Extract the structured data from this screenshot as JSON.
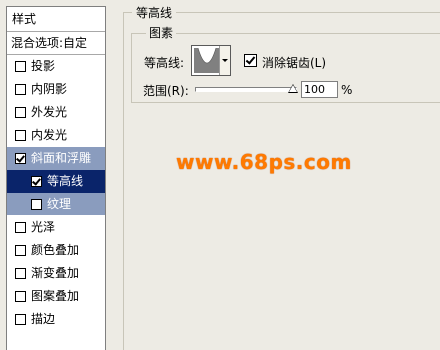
{
  "styles_panel": {
    "header": "样式",
    "blend_options": "混合选项:自定",
    "items": [
      {
        "label": "投影",
        "checked": false
      },
      {
        "label": "内阴影",
        "checked": false
      },
      {
        "label": "外发光",
        "checked": false
      },
      {
        "label": "内发光",
        "checked": false
      },
      {
        "label": "斜面和浮雕",
        "checked": true
      },
      {
        "label": "等高线",
        "checked": true
      },
      {
        "label": "纹理",
        "checked": false
      },
      {
        "label": "光泽",
        "checked": false
      },
      {
        "label": "颜色叠加",
        "checked": false
      },
      {
        "label": "渐变叠加",
        "checked": false
      },
      {
        "label": "图案叠加",
        "checked": false
      },
      {
        "label": "描边",
        "checked": false
      }
    ]
  },
  "contour_section": {
    "title": "等高线",
    "group_title": "图素",
    "contour_label": "等高线:",
    "antialias_label": "消除锯齿(L)",
    "antialias_checked": true,
    "range_label": "范围(R):",
    "range_value": "100",
    "range_unit": "%"
  },
  "watermark": "www.68ps.com"
}
